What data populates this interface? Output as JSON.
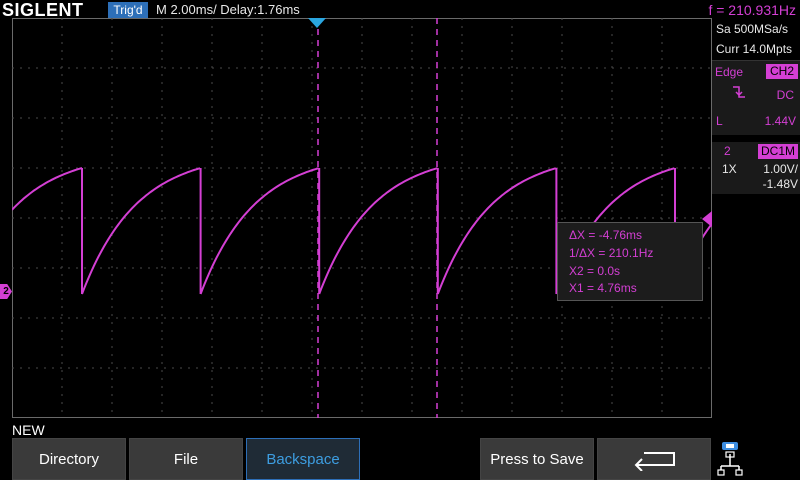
{
  "header": {
    "brand": "SIGLENT",
    "trigger_status": "Trig'd",
    "timebase": "M 2.00ms/ Delay:1.76ms",
    "frequency": "f = 210.931Hz"
  },
  "acquisition": {
    "sample_rate": "Sa 500MSa/s",
    "memory_depth": "Curr 14.0Mpts"
  },
  "trigger_panel": {
    "type": "Edge",
    "source": "CH2",
    "coupling": "DC",
    "level_label": "L",
    "level": "1.44V"
  },
  "channel_panel": {
    "number": "2",
    "coupling": "DC1M",
    "probe": "1X",
    "scale": "1.00V/",
    "offset": "-1.48V"
  },
  "channel_marker": "2",
  "cursor_readout": {
    "delta_x": "ΔX = -4.76ms",
    "inverse_delta_x": "1/ΔX = 210.1Hz",
    "x2": "X2 = 0.0s",
    "x1": "X1 = 4.76ms"
  },
  "input_label": "NEW",
  "softkeys": {
    "directory": "Directory",
    "file": "File",
    "backspace": "Backspace",
    "press_to_save": "Press to Save",
    "back_icon": "return-arrow-icon",
    "usb_icon": "usb-network-icon"
  },
  "colors": {
    "trace": "#d43fd4",
    "accent_blue": "#2d6fb8",
    "grid": "#555555"
  }
}
